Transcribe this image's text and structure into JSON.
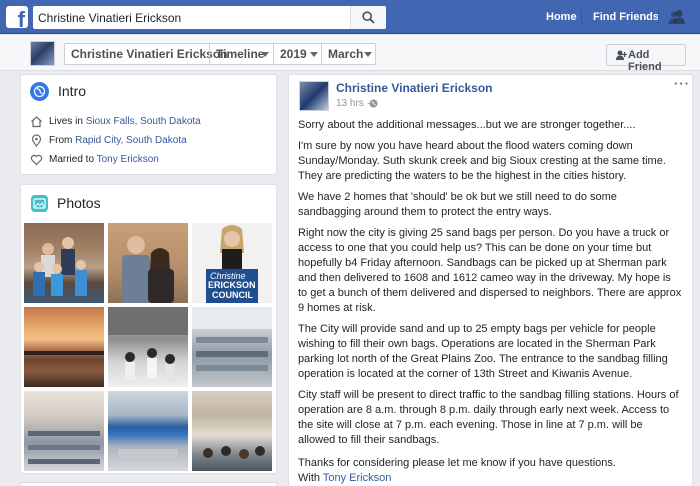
{
  "topbar": {
    "search_value": "Christine Vinatieri Erickson",
    "nav": [
      "Home",
      "Find Friends"
    ]
  },
  "header": {
    "profile_name": "Christine Vinatieri Erickson",
    "timeline_label": "Timeline",
    "year_label": "2019",
    "month_label": "March",
    "add_friend_label": "Add Friend"
  },
  "intro": {
    "title": "Intro",
    "lives_prefix": "Lives in ",
    "lives_link": "Sioux Falls, South Dakota",
    "from_prefix": "From ",
    "from_link": "Rapid City, South Dakota",
    "married_prefix": "Married to ",
    "married_link": "Tony Erickson"
  },
  "photos": {
    "title": "Photos",
    "sign_line1": "Christine",
    "sign_line2": "ERICKSON",
    "sign_line3": "COUNCIL"
  },
  "post": {
    "author": "Christine Vinatieri Erickson",
    "time": "13 hrs ·",
    "paragraphs": [
      [
        "Sorry about the additional messages...but we are stronger together...."
      ],
      [
        "I'm sure by now you have heard about the flood waters coming down",
        "Sunday/Monday. Suth skunk creek and big Sioux cresting at the same time.",
        "They are predicting the waters to be the highest in the cities history."
      ],
      [
        "We have 2 homes that 'should' be ok but we still need to do some",
        "sandbagging around them to protect the entry ways."
      ],
      [
        "Right now the city is giving 25 sand bags per person. Do you have a truck or",
        "access to one that you could help us? This can be done on your time but",
        "hopefully b4 Friday afternoon. Sandbags can be picked up at Sherman park",
        "and then delivered to 1608 and 1612 cameo way in the driveway. My hope is",
        "to get a bunch of them delivered and dispersed to neighbors. There are approx",
        "9 homes at risk."
      ],
      [
        "The City will provide sand and up to 25 empty bags per vehicle for people",
        "wishing to fill their own bags. Operations are located in the Sherman Park",
        "parking lot north of the Great Plains Zoo. The entrance to the sandbag filling",
        "operation is located at the corner of 13th Street and Kiwanis Avenue."
      ],
      [
        "City staff will be present to direct traffic to the sandbag filling stations. Hours of",
        "operation are 8 a.m. through 8 p.m. daily through early next week. Access to",
        "the site will close at 7 p.m. each evening. Those in line at 7 p.m. will be",
        "allowed to fill their sandbags."
      ],
      [
        "Thanks for considering please let me know if you have questions."
      ]
    ],
    "with_prefix": "With ",
    "with_link": "Tony Erickson"
  },
  "colors": {
    "brand": "#4267b2",
    "link": "#365899",
    "page_bg": "#e9ebee"
  }
}
